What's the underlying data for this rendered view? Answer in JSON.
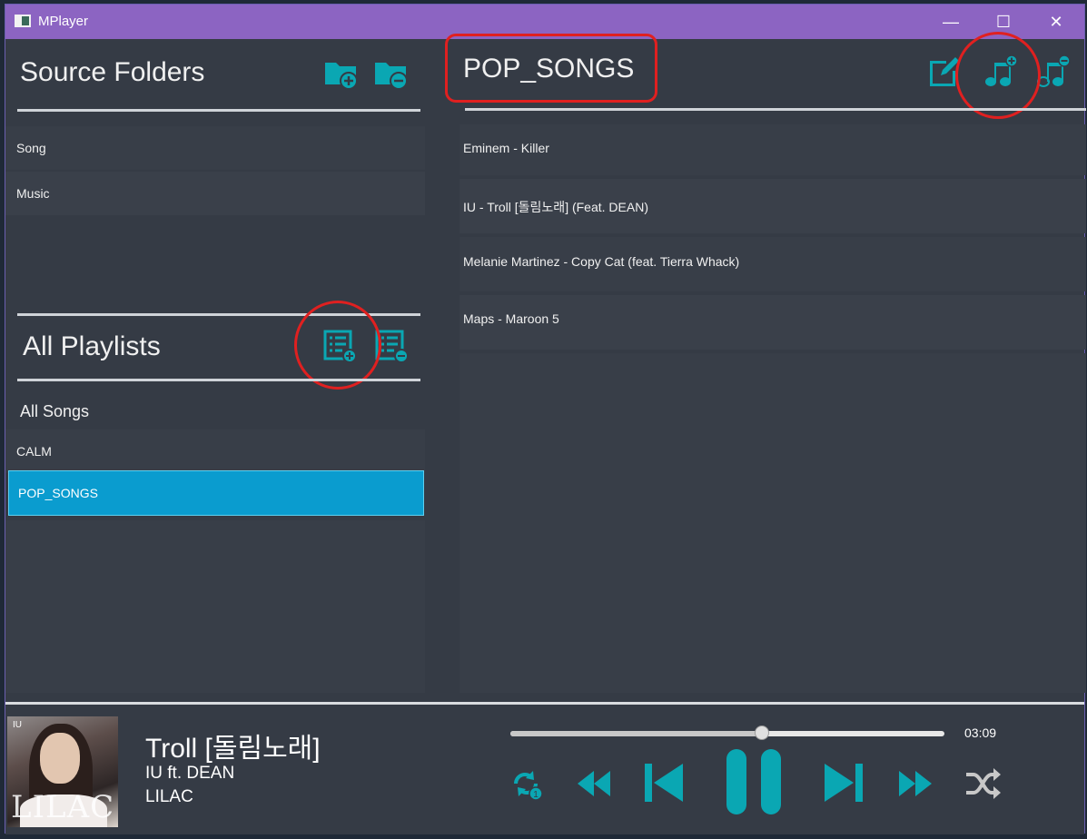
{
  "window": {
    "title": "MPlayer",
    "minimize": "—",
    "maximize": "☐",
    "close": "✕"
  },
  "sources": {
    "title": "Source Folders",
    "items": [
      {
        "label": "Song"
      },
      {
        "label": "Music"
      }
    ]
  },
  "playlists": {
    "title": "All Playlists",
    "all_songs": "All Songs",
    "items": [
      {
        "label": "CALM"
      },
      {
        "label": "POP_SONGS"
      }
    ]
  },
  "current_playlist": {
    "title": "POP_SONGS",
    "songs": [
      {
        "label": "Eminem - Killer"
      },
      {
        "label": "IU - Troll [돌림노래] (Feat. DEAN)"
      },
      {
        "label": "Melanie Martinez - Copy Cat (feat. Tierra Whack)"
      },
      {
        "label": "Maps - Maroon 5"
      }
    ]
  },
  "now_playing": {
    "title": "Troll [돌림노래]",
    "artist": "IU ft. DEAN",
    "album": "LILAC",
    "album_art_text": "LILAC",
    "album_art_small": "IU",
    "time": "03:09",
    "progress": 0.58
  },
  "colors": {
    "accent": "#0aa7b3",
    "titlebar": "#8c64c2",
    "selected": "#0a9ccf",
    "annotation": "#e02020"
  },
  "icons": {
    "add_folder": "folder-plus-icon",
    "remove_folder": "folder-minus-icon",
    "add_playlist": "playlist-plus-icon",
    "remove_playlist": "playlist-minus-icon",
    "edit": "edit-icon",
    "add_song": "music-plus-icon",
    "remove_song": "music-minus-icon",
    "repeat": "repeat-one-icon",
    "rewind": "rewind-icon",
    "previous": "skip-previous-icon",
    "pause": "pause-icon",
    "next": "skip-next-icon",
    "forward": "fast-forward-icon",
    "shuffle": "shuffle-icon"
  }
}
